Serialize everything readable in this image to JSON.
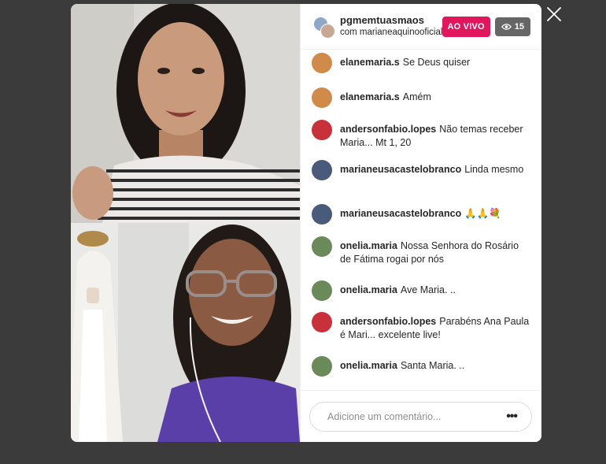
{
  "header": {
    "host_username": "pgmemtuasmaos",
    "with_text": "com marianeaquinooficial",
    "live_label": "AO VIVO",
    "viewer_count": "15"
  },
  "comments": [
    {
      "user": "elanemaria.s",
      "text": "Se Deus quiser",
      "avatar_color": "#d08a4a"
    },
    {
      "user": "elanemaria.s",
      "text": "Amém",
      "avatar_color": "#d08a4a"
    },
    {
      "user": "andersonfabio.lopes",
      "text": "Não temas receber Maria... Mt 1, 20",
      "avatar_color": "#c8303a"
    },
    {
      "user": "marianeusacastelobranco",
      "text": "Linda mesmo",
      "avatar_color": "#4a5a7a"
    },
    {
      "user": "marianeusacastelobranco",
      "text": "🙏🙏💐",
      "avatar_color": "#4a5a7a"
    },
    {
      "user": "onelia.maria",
      "text": "Nossa Senhora do Rosário de Fátima rogai por nós",
      "avatar_color": "#6a8a5a"
    },
    {
      "user": "onelia.maria",
      "text": "Ave Maria. ..",
      "avatar_color": "#6a8a5a"
    },
    {
      "user": "andersonfabio.lopes",
      "text": "Parabéns Ana Paula é Mari... excelente live!",
      "avatar_color": "#c8303a"
    },
    {
      "user": "onelia.maria",
      "text": "Santa Maria. ..",
      "avatar_color": "#6a8a5a"
    }
  ],
  "footer": {
    "comment_placeholder": "Adicione um comentário...",
    "more_label": "•••"
  },
  "colors": {
    "live_badge": "#e2165d",
    "viewer_badge": "#666666",
    "backdrop": "#3b3b3b"
  }
}
